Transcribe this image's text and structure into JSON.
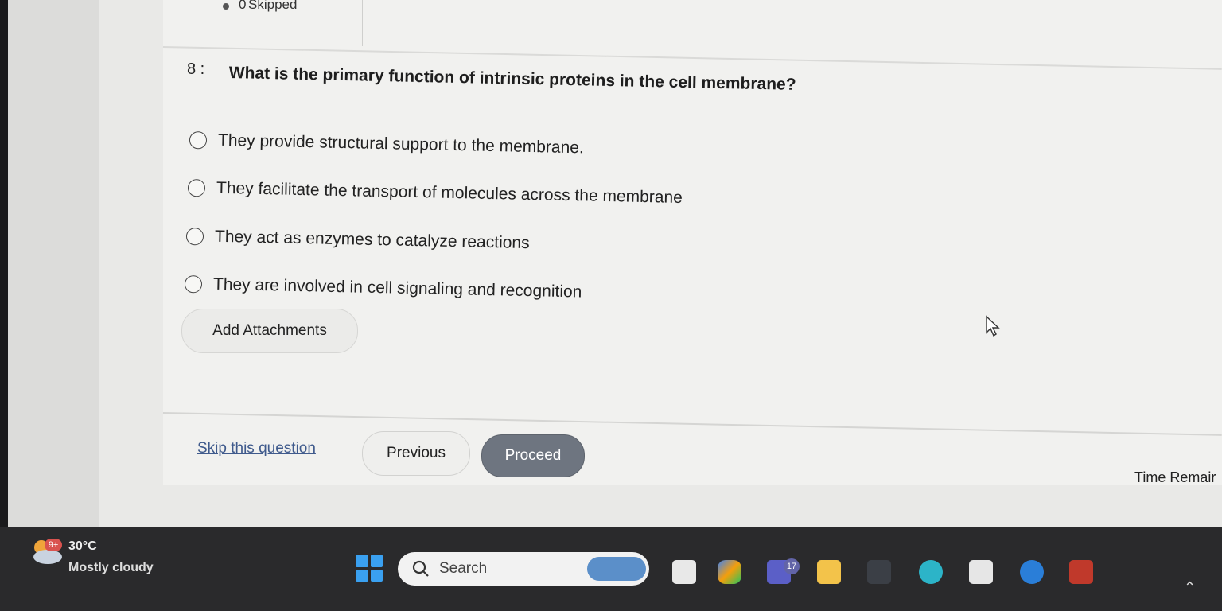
{
  "status": {
    "skipped_count": "0",
    "skipped_label": "Skipped"
  },
  "question": {
    "number": "8 :",
    "text": "What is the primary function of intrinsic proteins in the cell membrane?"
  },
  "options": [
    "They provide structural support to the membrane.",
    "They facilitate the transport of molecules across the membrane",
    "They act as enzymes to catalyze reactions",
    "They are involved in cell signaling and recognition"
  ],
  "buttons": {
    "add_attachments": "Add Attachments",
    "skip": "Skip this question",
    "previous": "Previous",
    "proceed": "Proceed"
  },
  "time_remaining_label": "Time Remair",
  "taskbar": {
    "weather_badge": "9+",
    "temperature": "30°C",
    "condition": "Mostly cloudy",
    "search_placeholder": "Search",
    "teams_badge": "17"
  },
  "icons": [
    "weather-cloud-icon",
    "windows-start-icon",
    "search-icon",
    "task-view-icon",
    "copilot-icon",
    "teams-icon",
    "file-explorer-icon",
    "myhp-icon",
    "edge-icon",
    "microsoft-store-icon",
    "help-icon",
    "mcafee-icon",
    "chevron-up-icon",
    "mouse-cursor-icon"
  ]
}
